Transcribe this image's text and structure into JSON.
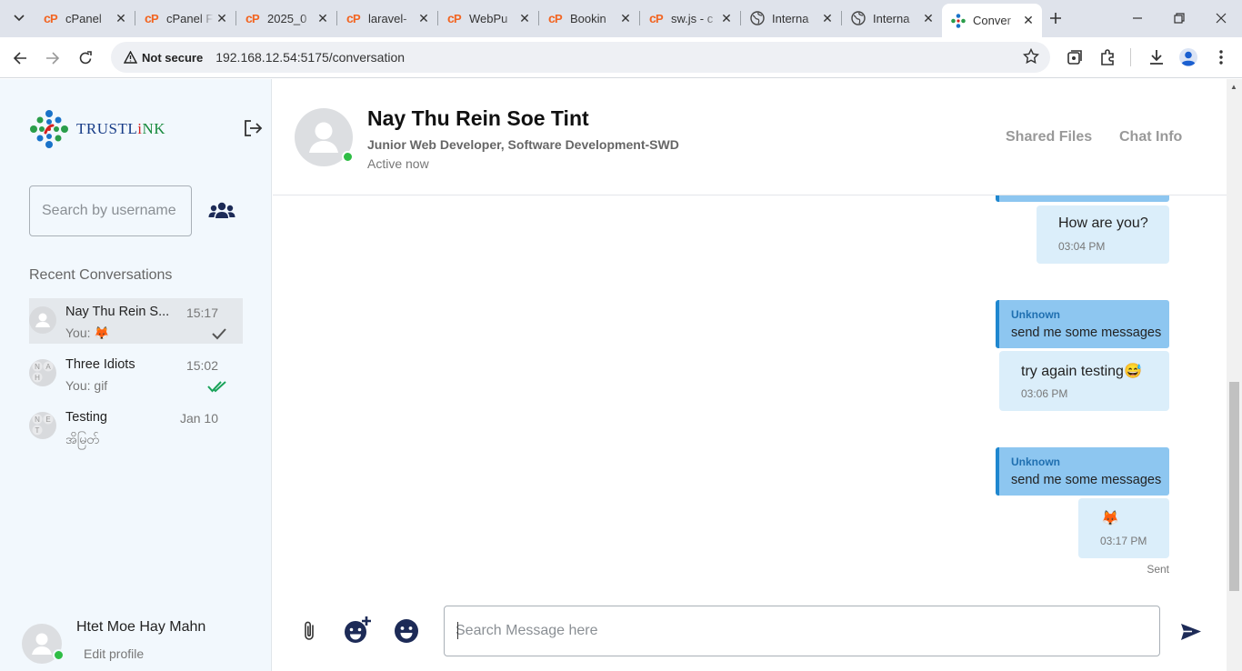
{
  "browser": {
    "tabs": [
      {
        "title": "cPanel",
        "icon": "cpanel-icon"
      },
      {
        "title": "cPanel F",
        "icon": "cpanel-icon"
      },
      {
        "title": "2025_0",
        "icon": "cpanel-icon"
      },
      {
        "title": "laravel-",
        "icon": "cpanel-icon"
      },
      {
        "title": "WebPu",
        "icon": "cpanel-icon"
      },
      {
        "title": "Bookin",
        "icon": "cpanel-icon"
      },
      {
        "title": "sw.js - c",
        "icon": "cpanel-icon"
      },
      {
        "title": "Interna",
        "icon": "globe-icon"
      },
      {
        "title": "Interna",
        "icon": "globe-icon"
      },
      {
        "title": "Conver",
        "icon": "trustlink-icon",
        "active": true
      }
    ],
    "security_label": "Not secure",
    "url": "192.168.12.54:5175/conversation"
  },
  "sidebar": {
    "logo_parts": {
      "a": "TRUSTL",
      "b": "i",
      "c": "NK"
    },
    "search_placeholder": "Search by username",
    "recent_title": "Recent Conversations",
    "conversations": [
      {
        "name": "Nay Thu Rein S...",
        "time": "15:17",
        "preview": "You: 🦊",
        "status": "sent"
      },
      {
        "name": "Three Idiots",
        "time": "15:02",
        "preview": "You: gif",
        "status": "read"
      },
      {
        "name": "Testing",
        "time": "Jan 10",
        "preview": "အိမြတ်",
        "status": ""
      }
    ],
    "user": {
      "name": "Htet Moe Hay Mahn",
      "edit_label": "Edit profile"
    }
  },
  "chat": {
    "name": "Nay Thu Rein Soe Tint",
    "role": "Junior Web Developer, Software Development-SWD",
    "status": "Active now",
    "links": [
      "Shared Files",
      "Chat Info"
    ],
    "messages": [
      {
        "text": "How are you?",
        "time": "03:04 PM"
      },
      {
        "reply_to": {
          "sender": "Unknown",
          "text": "send me some messages"
        },
        "text": "try again testing😅",
        "time": "03:06 PM"
      },
      {
        "reply_to": {
          "sender": "Unknown",
          "text": "send me some messages"
        },
        "text": "🦊",
        "time": "03:17 PM"
      }
    ],
    "sent_label": "Sent",
    "input_placeholder": "Search Message here"
  },
  "colors": {
    "sidebar_bg": "#f2f8fd",
    "bubble_bg": "#dbeefa",
    "reply_bg": "#8dc6f0",
    "reply_border": "#1f87cf",
    "online": "#2fbd45",
    "read_tick": "#1aa35a",
    "icon_dark": "#1d2b57"
  }
}
